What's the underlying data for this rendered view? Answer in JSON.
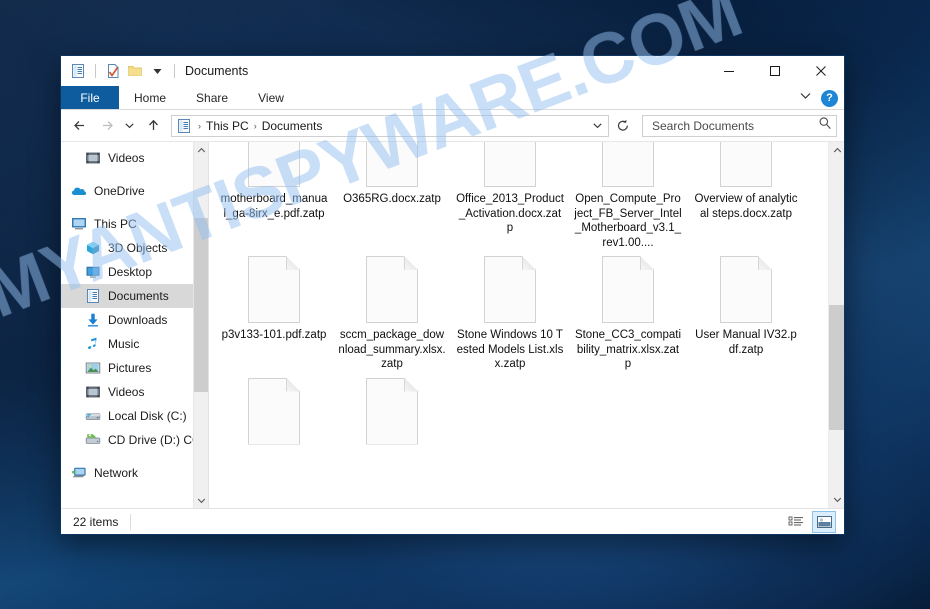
{
  "desktop": {
    "watermark": "MYANTISPYWARE.COM"
  },
  "window": {
    "title": "Documents",
    "quick_access": [
      {
        "name": "documents-properties-icon",
        "label": "Documents"
      },
      {
        "name": "properties-icon",
        "label": "Properties"
      },
      {
        "name": "new-folder-icon",
        "label": "New folder"
      },
      {
        "name": "customize-qat-icon",
        "label": "Customize Quick Access Toolbar"
      }
    ],
    "controls": {
      "minimize": "Minimize",
      "maximize": "Maximize",
      "close": "Close"
    }
  },
  "ribbon": {
    "tabs": [
      {
        "label": "File",
        "active": true
      },
      {
        "label": "Home",
        "active": false
      },
      {
        "label": "Share",
        "active": false
      },
      {
        "label": "View",
        "active": false
      }
    ],
    "expand_label": "Expand the Ribbon",
    "help_label": "?"
  },
  "addressbar": {
    "back": "Back",
    "forward": "Forward",
    "recent": "Recent locations",
    "up": "Up",
    "breadcrumbs": [
      "This PC",
      "Documents"
    ],
    "separator": "›",
    "dropdown": "Previous locations",
    "refresh": "Refresh"
  },
  "search": {
    "placeholder": "Search Documents",
    "value": ""
  },
  "sidebar": {
    "items": [
      {
        "label": "Videos",
        "icon": "videos-icon",
        "indent": 1,
        "selected": false,
        "gap_before": false
      },
      {
        "label": "OneDrive",
        "icon": "onedrive-icon",
        "indent": 0,
        "selected": false,
        "gap_before": true
      },
      {
        "label": "This PC",
        "icon": "this-pc-icon",
        "indent": 0,
        "selected": false,
        "gap_before": true
      },
      {
        "label": "3D Objects",
        "icon": "3d-objects-icon",
        "indent": 1,
        "selected": false,
        "gap_before": false
      },
      {
        "label": "Desktop",
        "icon": "desktop-icon",
        "indent": 1,
        "selected": false,
        "gap_before": false
      },
      {
        "label": "Documents",
        "icon": "documents-icon",
        "indent": 1,
        "selected": true,
        "gap_before": false
      },
      {
        "label": "Downloads",
        "icon": "downloads-icon",
        "indent": 1,
        "selected": false,
        "gap_before": false
      },
      {
        "label": "Music",
        "icon": "music-icon",
        "indent": 1,
        "selected": false,
        "gap_before": false
      },
      {
        "label": "Pictures",
        "icon": "pictures-icon",
        "indent": 1,
        "selected": false,
        "gap_before": false
      },
      {
        "label": "Videos",
        "icon": "videos-icon",
        "indent": 1,
        "selected": false,
        "gap_before": false
      },
      {
        "label": "Local Disk (C:)",
        "icon": "local-disk-icon",
        "indent": 1,
        "selected": false,
        "gap_before": false
      },
      {
        "label": "CD Drive (D:) CC",
        "icon": "cd-drive-icon",
        "indent": 1,
        "selected": false,
        "gap_before": false
      },
      {
        "label": "Network",
        "icon": "network-icon",
        "indent": 0,
        "selected": false,
        "gap_before": true
      }
    ]
  },
  "files": {
    "rows": [
      [
        {
          "name": "motherboard_manual_ga-8irx_e.pdf.zatp",
          "icon": "blank-file-icon"
        },
        {
          "name": "O365RG.docx.zatp",
          "icon": "blank-file-icon"
        },
        {
          "name": "Office_2013_Product_Activation.docx.zatp",
          "icon": "blank-file-icon"
        },
        {
          "name": "Open_Compute_Project_FB_Server_Intel_Motherboard_v3.1_rev1.00....",
          "icon": "blank-file-icon"
        },
        {
          "name": "Overview of analytical steps.docx.zatp",
          "icon": "blank-file-icon"
        }
      ],
      [
        {
          "name": "p3v133-101.pdf.zatp",
          "icon": "blank-file-icon"
        },
        {
          "name": "sccm_package_download_summary.xlsx.zatp",
          "icon": "blank-file-icon"
        },
        {
          "name": "Stone Windows 10 Tested Models List.xlsx.zatp",
          "icon": "blank-file-icon"
        },
        {
          "name": "Stone_CC3_compatibility_matrix.xlsx.zatp",
          "icon": "blank-file-icon"
        },
        {
          "name": "User Manual IV32.pdf.zatp",
          "icon": "blank-file-icon"
        }
      ],
      [
        {
          "name": "",
          "icon": "blank-file-icon"
        },
        {
          "name": "",
          "icon": "blank-file-icon"
        }
      ]
    ]
  },
  "statusbar": {
    "item_count": "22 items",
    "views": [
      {
        "name": "details-view-button",
        "label": "Details view",
        "active": false
      },
      {
        "name": "large-icons-view-button",
        "label": "Large icons view",
        "active": true
      }
    ]
  },
  "colors": {
    "file_tab": "#0e5c9e",
    "selection": "#d8d8d8",
    "help_blue": "#1f86d6",
    "watermark": "#78afeb"
  }
}
